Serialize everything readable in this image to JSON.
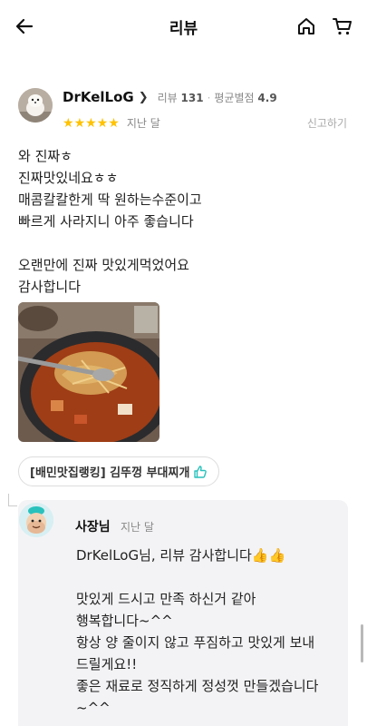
{
  "header": {
    "title": "리뷰",
    "icons": {
      "back": "back-arrow-icon",
      "home": "home-icon",
      "cart": "cart-icon"
    }
  },
  "review": {
    "nickname": "DrKelLoG",
    "review_count_label": "리뷰",
    "review_count": "131",
    "avg_rating_label": "평균별점",
    "avg_rating": "4.9",
    "stars": 5,
    "date": "지난 달",
    "report_label": "신고하기",
    "lines": [
      "와 진짜ㅎ",
      "진짜맛있네요ㅎㅎ",
      "매콤칼칼한게 딱 원하는수준이고",
      "빠르게 사라지니 아주 좋습니다",
      "",
      "오랜만에 진짜 맛있게먹었어요",
      "감사합니다"
    ],
    "menu_tag": "[배민맛집랭킹] 김뚜껑 부대찌개"
  },
  "owner_reply": {
    "name": "사장님",
    "date": "지난 달",
    "lines": [
      "DrKelLoG님, 리뷰 감사합니다👍👍",
      "",
      "맛있게 드시고 만족 하신거 같아",
      "행복합니다~^^",
      "항상 양 줄이지 않고 푸짐하고 맛있게 보내",
      "드릴게요!!",
      "좋은 재료로 정직하게 정성껏 만들겠습니다",
      "~^^"
    ]
  },
  "colors": {
    "star": "#ffc200",
    "thumb": "#2ac1bc"
  }
}
